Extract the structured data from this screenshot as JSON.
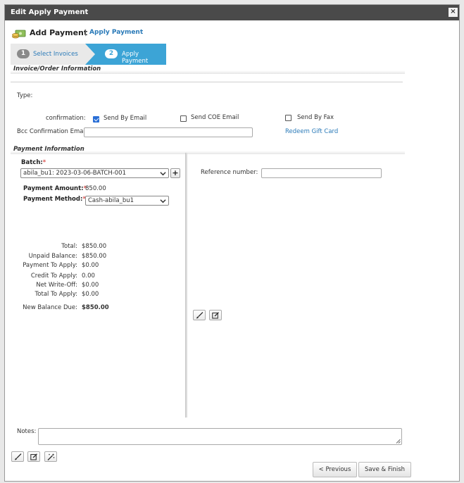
{
  "window": {
    "title": "Edit Apply Payment",
    "close_glyph": "×"
  },
  "header": {
    "title": "Add Payment",
    "separator": "|",
    "subtitle": "Apply Payment",
    "icon": "money-icon"
  },
  "steps": [
    {
      "num": "1",
      "label": "Select Invoices"
    },
    {
      "num": "2",
      "label": "Apply Payment"
    }
  ],
  "invoice_section": {
    "heading": "Invoice/Order Information",
    "type_label": "Type:",
    "confirmation_label": "confirmation:",
    "send_by_email": {
      "label": "Send By Email",
      "checked": true
    },
    "send_coe_email": {
      "label": "Send COE Email",
      "checked": false
    },
    "send_by_fax": {
      "label": "Send By Fax",
      "checked": false
    },
    "bcc_label": "Bcc Confirmation Email:",
    "bcc_value": "",
    "redeem_gift_card": "Redeem Gift Card"
  },
  "payment_section": {
    "heading": "Payment Information",
    "batch_label": "Batch:",
    "batch_value": "abila_bu1: 2023-03-06-BATCH-001",
    "add_batch_glyph": "+",
    "amount_label": "Payment Amount:",
    "amount_value": "850.00",
    "method_label": "Payment Method:",
    "method_value": "Cash-abila_bu1",
    "reference_label": "Reference number:",
    "reference_value": "",
    "required_mark": "*"
  },
  "summary": [
    {
      "label": "Total:",
      "value": "$850.00"
    },
    {
      "label": "Unpaid Balance:",
      "value": "$850.00"
    },
    {
      "label": "Payment To Apply:",
      "value": "$0.00"
    },
    {
      "label": "Credit To Apply:",
      "value": "0.00"
    },
    {
      "label": "Net Write-Off:",
      "value": "$0.00"
    },
    {
      "label": "Total To Apply:",
      "value": "$0.00"
    }
  ],
  "new_balance": {
    "label": "New Balance Due:",
    "value": "$850.00"
  },
  "notes": {
    "label": "Notes:",
    "value": ""
  },
  "footer": {
    "previous": "< Previous",
    "save_finish": "Save & Finish"
  },
  "colors": {
    "titlebar": "#4a4a4a",
    "active_step": "#3ca4d6",
    "link": "#2a7ab8",
    "required": "#d9534f"
  }
}
